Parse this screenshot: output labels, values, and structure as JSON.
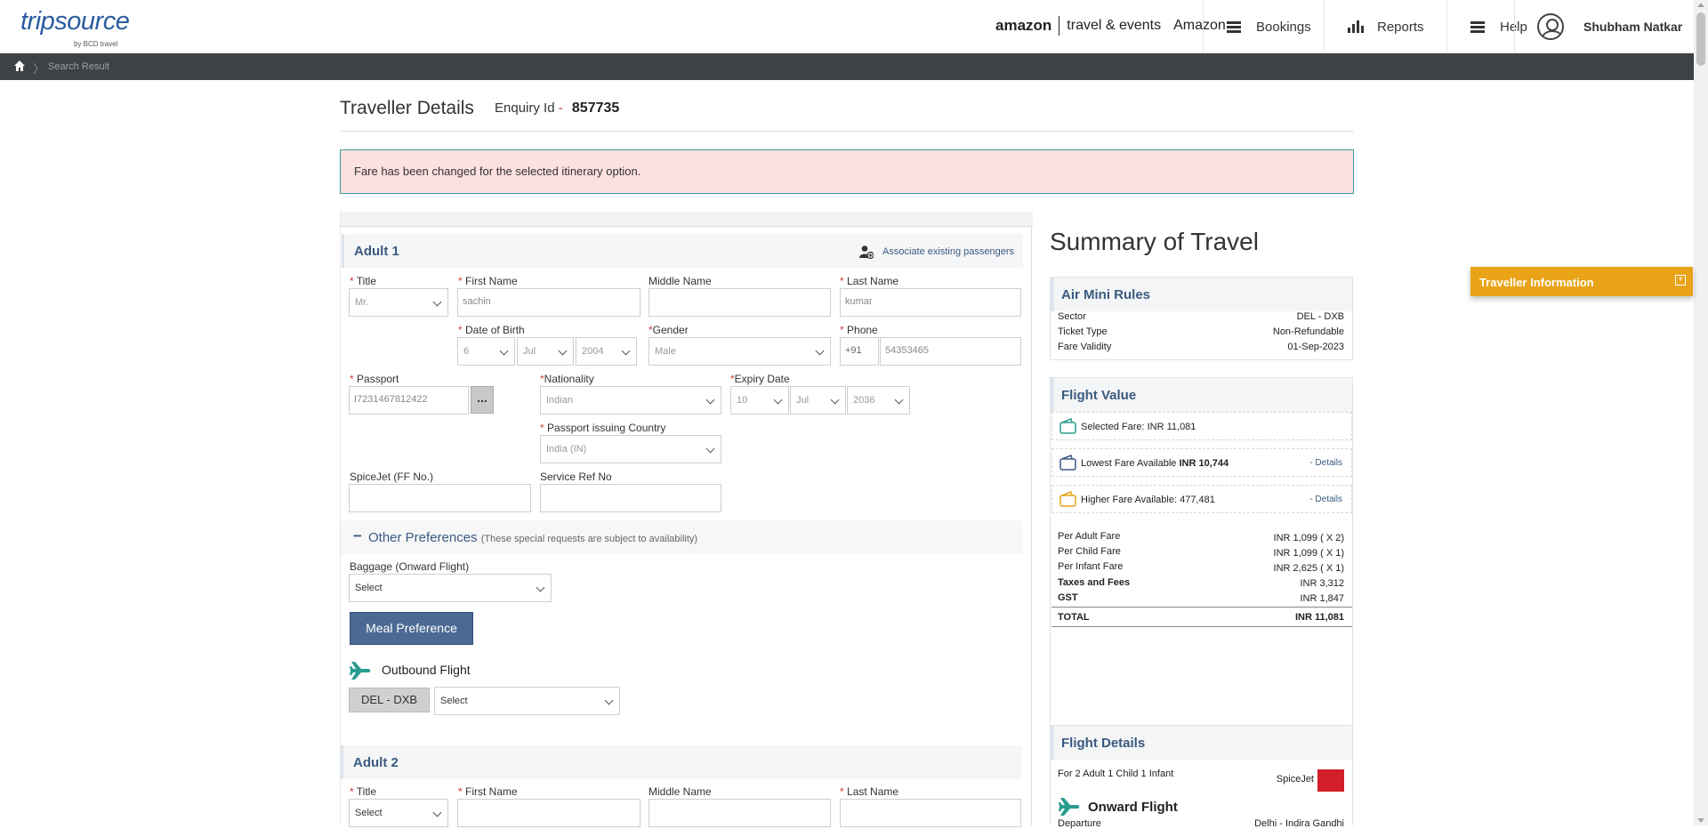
{
  "header": {
    "logo_main": "tripsource",
    "logo_sub": "by BCD travel",
    "brand_amazon": "amazon",
    "brand_events": "travel & events",
    "brand_company": "Amazon",
    "nav": [
      {
        "label": "Bookings",
        "icon": "hamburger-icon"
      },
      {
        "label": "Reports",
        "icon": "bar-chart-icon"
      },
      {
        "label": "Help",
        "icon": "hamburger-icon"
      }
    ],
    "user_name": "Shubham Natkar"
  },
  "breadcrumb": {
    "current": "Search Result"
  },
  "page": {
    "title": "Traveller Details",
    "enquiry_label": "Enquiry Id",
    "enquiry_dash": "-",
    "enquiry_id": "857735"
  },
  "alert": {
    "message": "Fare has been changed for the selected itinerary option."
  },
  "adult1": {
    "heading": "Adult 1",
    "associate_label": "Associate existing passengers",
    "title_label": "Title",
    "title_value": "Mr.",
    "first_name_label": "First Name",
    "first_name_value": "sachin",
    "middle_name_label": "Middle Name",
    "middle_name_value": "",
    "last_name_label": "Last Name",
    "last_name_value": "kumar",
    "dob_label": "Date of Birth",
    "dob_day": "6",
    "dob_month": "Jul",
    "dob_year": "2004",
    "gender_label": "Gender",
    "gender_value": "Male",
    "phone_label": "Phone",
    "phone_code": "+91",
    "phone_value": "54353465",
    "passport_label": "Passport",
    "passport_value": "I7231467812422",
    "passport_btn": "...",
    "nationality_label": "Nationality",
    "nationality_value": "Indian",
    "expiry_label": "Expiry Date",
    "expiry_day": "10",
    "expiry_month": "Jul",
    "expiry_year": "2036",
    "issuing_label": "Passport issuing Country",
    "issuing_value": "India (IN)",
    "ff_label": "SpiceJet (FF No.)",
    "ff_value": "",
    "serviceref_label": "Service Ref No",
    "serviceref_value": ""
  },
  "other_preferences": {
    "toggle": "−",
    "title": "Other Preferences",
    "note": "(These special requests are subject to availability)",
    "baggage_label": "Baggage (Onward Flight)",
    "baggage_value": "Select",
    "meal_button": "Meal Preference",
    "outbound_label": "Outbound Flight",
    "segment": "DEL - DXB",
    "meal_select": "Select"
  },
  "adult2": {
    "heading": "Adult 2",
    "title_label": "Title",
    "title_value": "Select",
    "first_name_label": "First Name",
    "middle_name_label": "Middle Name",
    "last_name_label": "Last Name"
  },
  "summary": {
    "title": "Summary of Travel",
    "mini_rules": {
      "heading": "Air Mini Rules",
      "rows": [
        {
          "k": "Sector",
          "v": "DEL - DXB"
        },
        {
          "k": "Ticket Type",
          "v": "Non-Refundable"
        },
        {
          "k": "Fare Validity",
          "v": "01-Sep-2023"
        }
      ]
    },
    "flight_value": {
      "heading": "Flight Value",
      "selected": "Selected Fare: INR 11,081",
      "lowest_label": "Lowest Fare Available ",
      "lowest_amount": "INR 10,744",
      "higher": "Higher Fare Available: 477,481",
      "details": "- Details",
      "breakdown": [
        {
          "k": "Per Adult Fare",
          "v": "INR 1,099 ( X 2)"
        },
        {
          "k": "Per Child Fare",
          "v": "INR 1,099 ( X 1)"
        },
        {
          "k": "Per Infant Fare",
          "v": "INR 2,625 ( X 1)"
        },
        {
          "k": "Taxes and Fees",
          "v": "INR 3,312"
        },
        {
          "k": "GST",
          "v": "INR 1,847"
        }
      ],
      "total_label": "TOTAL",
      "total_value": "INR 11,081"
    },
    "flight_details": {
      "heading": "Flight Details",
      "pax": "For 2 Adult 1 Child 1 Infant",
      "airline": "SpiceJet",
      "onward": "Onward Flight",
      "departure_label": "Departure",
      "departure_value": "Delhi - Indira Gandhi"
    }
  },
  "traveller_info_tab": {
    "label": "Traveller Information",
    "toggle": "+"
  },
  "colors": {
    "brand_blue": "#2a5d9f",
    "accent_orange": "#e8a317",
    "alert_bg": "#fde0e0",
    "section_blue": "#3a5a80",
    "plane_teal": "#2a9d8f"
  }
}
